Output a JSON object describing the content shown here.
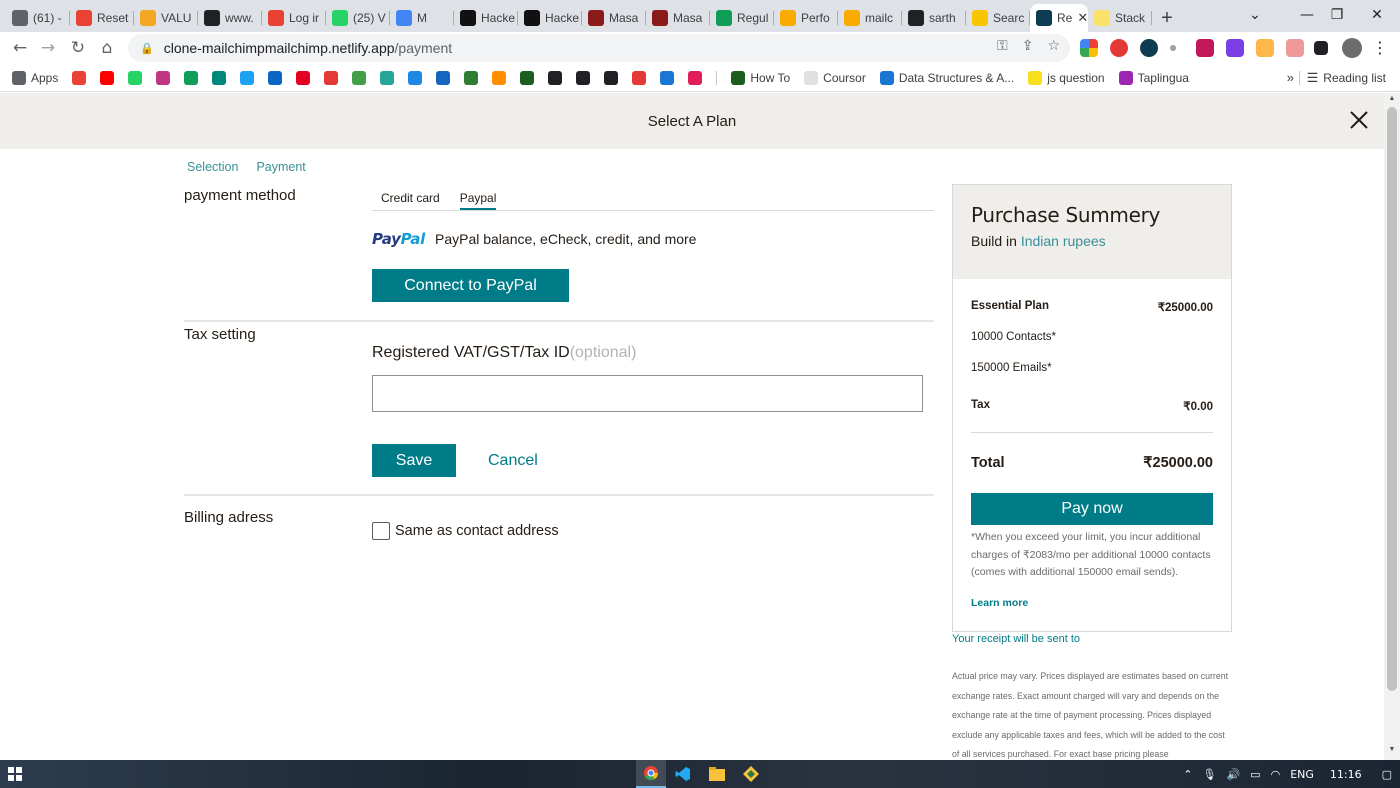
{
  "browser": {
    "tabs": [
      {
        "label": "(61) -",
        "favicon": "#5f6368"
      },
      {
        "label": "Reset",
        "favicon": "#ea4335"
      },
      {
        "label": "VALU",
        "favicon": "#f5a623"
      },
      {
        "label": "www.",
        "favicon": "#202124"
      },
      {
        "label": "Log ir",
        "favicon": "#e94235"
      },
      {
        "label": "(25) V",
        "favicon": "#25d366"
      },
      {
        "label": "M",
        "favicon": "#4285f4"
      },
      {
        "label": "Hacke",
        "favicon": "#111111"
      },
      {
        "label": "Hacke",
        "favicon": "#111111"
      },
      {
        "label": "Masa",
        "favicon": "#8b1a1a"
      },
      {
        "label": "Masa",
        "favicon": "#8b1a1a"
      },
      {
        "label": "Regul",
        "favicon": "#0f9d58"
      },
      {
        "label": "Perfo",
        "favicon": "#f9ab00"
      },
      {
        "label": "mailc",
        "favicon": "#f9ab00"
      },
      {
        "label": "sarth",
        "favicon": "#202124"
      },
      {
        "label": "Searc",
        "favicon": "#f7c600"
      },
      {
        "label": "Re",
        "favicon": "#0e3c52",
        "active": true
      },
      {
        "label": "Stack",
        "favicon": "#f9e267"
      }
    ],
    "url_host": "clone-mailchimpmailchimp.netlify.app",
    "url_path": "/payment",
    "bookmarks": [
      {
        "label": "Apps",
        "color": "#5f6368"
      },
      {
        "label": "",
        "color": "#ea4335"
      },
      {
        "label": "",
        "color": "#ff0000"
      },
      {
        "label": "",
        "color": "#25d366"
      },
      {
        "label": "",
        "color": "#c13584"
      },
      {
        "label": "",
        "color": "#0f9d58"
      },
      {
        "label": "",
        "color": "#00897b"
      },
      {
        "label": "",
        "color": "#1da1f2"
      },
      {
        "label": "",
        "color": "#0a66c2"
      },
      {
        "label": "",
        "color": "#e60023"
      },
      {
        "label": "",
        "color": "#e53935"
      },
      {
        "label": "",
        "color": "#43a047"
      },
      {
        "label": "",
        "color": "#26a69a"
      },
      {
        "label": "",
        "color": "#1e88e5"
      },
      {
        "label": "",
        "color": "#1565c0"
      },
      {
        "label": "",
        "color": "#2e7d32"
      },
      {
        "label": "",
        "color": "#ff8f00"
      },
      {
        "label": "",
        "color": "#1b5e20"
      },
      {
        "label": "",
        "color": "#202124"
      },
      {
        "label": "",
        "color": "#202124"
      },
      {
        "label": "",
        "color": "#202124"
      },
      {
        "label": "",
        "color": "#e53935"
      },
      {
        "label": "",
        "color": "#1976d2"
      },
      {
        "label": "",
        "color": "#e01e5a"
      },
      {
        "label": "How To",
        "color": "#1b5e20"
      },
      {
        "label": "Coursor",
        "color": "#e0e0e0"
      },
      {
        "label": "Data Structures & A...",
        "color": "#1976d2"
      },
      {
        "label": "js question",
        "color": "#f7df1e"
      },
      {
        "label": "Taplingua",
        "color": "#9c27b0"
      }
    ],
    "reading_list": "Reading list"
  },
  "header": {
    "title": "Select A Plan"
  },
  "breadcrumb": {
    "step1": "Selection",
    "step2": "Payment"
  },
  "payment_method": {
    "label": "payment method",
    "tab_credit": "Credit card",
    "tab_paypal": "Paypal",
    "paypal_word1": "Pay",
    "paypal_word2": "Pal",
    "paypal_text": "PayPal balance, eCheck, credit, and more",
    "connect_button": "Connect to PayPal"
  },
  "tax": {
    "label": "Tax setting",
    "field_label": "Registered VAT/GST/Tax ID",
    "field_optional": "(optional)",
    "field_value": "",
    "save_button": "Save",
    "cancel_button": "Cancel"
  },
  "billing": {
    "label": "Billing adress",
    "same_as_contact": "Same as contact address",
    "checked": false
  },
  "summary": {
    "title": "Purchase Summery",
    "build_in": "Build in",
    "currency": "Indian rupees",
    "plan_name": "Essential Plan",
    "plan_price": "₹25000.00",
    "contacts": "10000 Contacts*",
    "emails": "150000 Emails*",
    "tax_label": "Tax",
    "tax_value": "₹0.00",
    "total_label": "Total",
    "total_value": "₹25000.00",
    "pay_button": "Pay now",
    "note": "*When you exceed your limit, you incur additional charges of ₹2083/mo per additional 10000 contacts (comes with additional 150000 email sends).",
    "learn_more": "Learn more"
  },
  "receipt": "Your receipt will be sent to",
  "fine_print": "Actual price may vary. Prices displayed are estimates based on current exchange rates. Exact amount charged will vary and depends on the exchange rate at the time of payment processing. Prices displayed exclude any applicable taxes and fees, which will be added to the cost of all services purchased. For exact base pricing please",
  "taskbar": {
    "language": "ENG",
    "time": "11:16"
  },
  "colors": {
    "accent": "#007c89",
    "link": "#3b8f9a",
    "header_bg": "#efeeea"
  }
}
